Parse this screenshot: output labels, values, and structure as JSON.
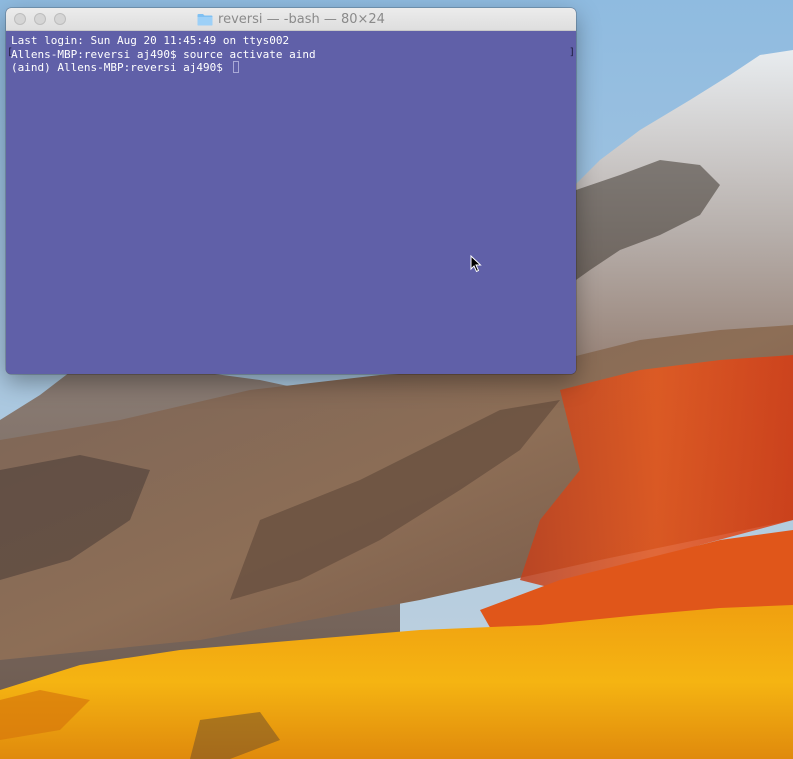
{
  "window": {
    "title": "reversi — -bash — 80×24",
    "icon": "folder-icon"
  },
  "terminal": {
    "lines": [
      "Last login: Sun Aug 20 11:45:49 on ttys002",
      "Allens-MBP:reversi aj490$ source activate aind",
      "(aind) Allens-MBP:reversi aj490$ "
    ],
    "background_color": "#6060a8",
    "text_color": "#ffffff"
  },
  "desktop": {
    "wallpaper": "high-sierra-mountain"
  },
  "pointer": {
    "icon": "mouse-pointer-icon"
  }
}
